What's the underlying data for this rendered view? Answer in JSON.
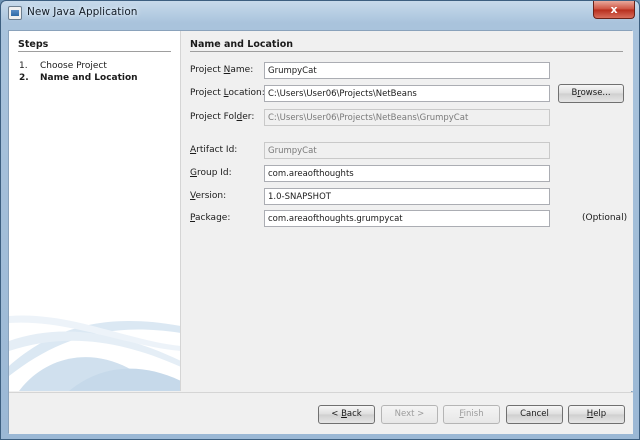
{
  "window": {
    "title": "New Java Application",
    "close_glyph": "x"
  },
  "steps": {
    "heading": "Steps",
    "items": [
      {
        "num": "1.",
        "label": "Choose Project"
      },
      {
        "num": "2.",
        "label": "Name and Location"
      }
    ]
  },
  "form": {
    "heading": "Name and Location",
    "project_name": {
      "label_pre": "Project ",
      "label_key": "N",
      "label_post": "ame:",
      "value": "GrumpyCat"
    },
    "project_location": {
      "label_pre": "Project ",
      "label_key": "L",
      "label_post": "ocation:",
      "value": "C:\\Users\\User06\\Projects\\NetBeans"
    },
    "browse_button": {
      "label_pre": "B",
      "label_key": "r",
      "label_post": "owse..."
    },
    "project_folder": {
      "label_pre": "Project Fol",
      "label_key": "d",
      "label_post": "er:",
      "value": "C:\\Users\\User06\\Projects\\NetBeans\\GrumpyCat"
    },
    "artifact_id": {
      "label_pre": "",
      "label_key": "A",
      "label_post": "rtifact Id:",
      "value": "GrumpyCat"
    },
    "group_id": {
      "label_pre": "",
      "label_key": "G",
      "label_post": "roup Id:",
      "value": "com.areaofthoughts"
    },
    "version": {
      "label_pre": "",
      "label_key": "V",
      "label_post": "ersion:",
      "value": "1.0-SNAPSHOT"
    },
    "package": {
      "label_pre": "",
      "label_key": "P",
      "label_post": "ackage:",
      "value": "com.areaofthoughts.grumpycat",
      "hint": "(Optional)"
    }
  },
  "buttons": {
    "back": {
      "pre": "< ",
      "key": "B",
      "post": "ack"
    },
    "next": {
      "label": "Next >"
    },
    "finish": {
      "pre": "",
      "key": "F",
      "post": "inish"
    },
    "cancel": {
      "label": "Cancel"
    },
    "help": {
      "pre": "",
      "key": "H",
      "post": "elp"
    }
  },
  "colors": {
    "accent": "#3d5f80",
    "window_frame": "#a9c3dc",
    "close": "#cd4e3c"
  }
}
